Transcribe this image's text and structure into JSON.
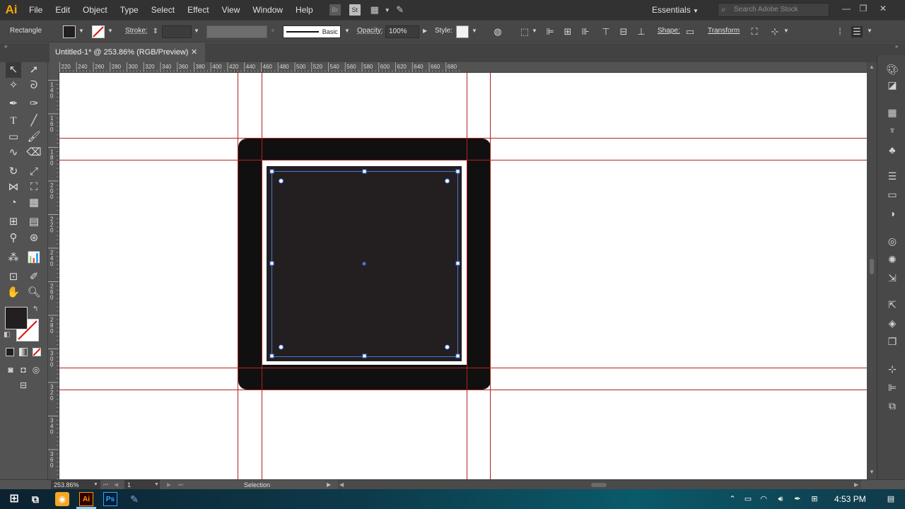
{
  "app": {
    "logo": "Ai",
    "menu": [
      "File",
      "Edit",
      "Object",
      "Type",
      "Select",
      "Effect",
      "View",
      "Window",
      "Help"
    ],
    "toolbar_shortcuts": {
      "bridge": "Br",
      "stock": "St"
    },
    "workspace": "Essentials",
    "search_placeholder": "Search Adobe Stock"
  },
  "control_bar": {
    "tool_name": "Rectangle",
    "stroke_label": "Stroke:",
    "brush_label": "Basic",
    "opacity_label": "Opacity:",
    "opacity_value": "100%",
    "style_label": "Style:",
    "shape_label": "Shape:",
    "transform_label": "Transform"
  },
  "document": {
    "tab_title": "Untitled-1* @ 253.86% (RGB/Preview)",
    "close_glyph": "✕"
  },
  "rulers": {
    "top_labels": [
      "220",
      "240",
      "260",
      "280",
      "300",
      "320",
      "340",
      "360",
      "380",
      "400",
      "420",
      "440",
      "460",
      "480",
      "500",
      "520",
      "540",
      "560",
      "580",
      "600",
      "620",
      "640",
      "660",
      "680"
    ],
    "left_labels": [
      "1\n4\n0",
      "1\n6\n0",
      "1\n8\n0",
      "2\n0\n0",
      "2\n2\n0",
      "2\n4\n0",
      "2\n6\n0",
      "2\n8\n0",
      "3\n0\n0",
      "3\n2\n0",
      "3\n4\n0",
      "3\n6\n0"
    ]
  },
  "status": {
    "zoom": "253.86%",
    "page": "1",
    "tool": "Selection"
  },
  "taskbar": {
    "clock": "4:53 PM",
    "ai_label": "Ai",
    "ps_label": "Ps"
  },
  "colors": {
    "guide": "#b22222",
    "outer_shape": "#111010",
    "inner_shape": "#231f20",
    "selection": "#4a74d8"
  }
}
